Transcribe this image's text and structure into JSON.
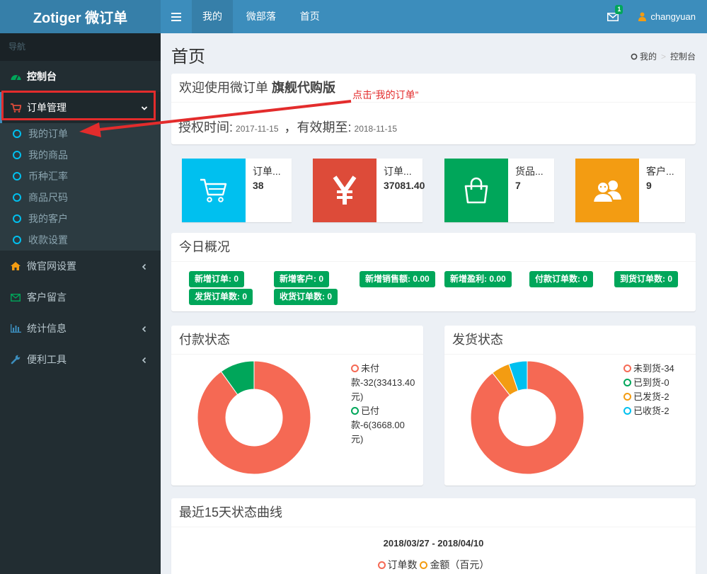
{
  "header": {
    "logo_text": "Zotiger 微订单",
    "nav": [
      {
        "label": "我的",
        "active": true
      },
      {
        "label": "微部落",
        "active": false
      },
      {
        "label": "首页",
        "active": false
      }
    ],
    "mail_badge": "1",
    "username": "changyuan"
  },
  "sidebar": {
    "header": "导航",
    "dashboard": "控制台",
    "order_mgmt": "订单管理",
    "sub_items": [
      "我的订单",
      "我的商品",
      "币种汇率",
      "商品尺码",
      "我的客户",
      "收款设置"
    ],
    "site_settings": "微官网设置",
    "messages": "客户留言",
    "stats": "统计信息",
    "tools": "便利工具"
  },
  "page": {
    "title": "首页",
    "breadcrumb": [
      "我的",
      "控制台"
    ]
  },
  "welcome": {
    "prefix": "欢迎使用微订单 ",
    "edition": "旗舰代购版",
    "auth_label": "授权时间:",
    "auth_date": "2017-11-15",
    "valid_label": "，有效期至:",
    "valid_date": "2018-11-15"
  },
  "annotation": "点击“我的订单”",
  "stats": [
    {
      "label": "订单...",
      "value": "38",
      "color": "#00c0ef",
      "icon": "cart-icon"
    },
    {
      "label": "订单...",
      "value": "37081.40",
      "color": "#dd4b39",
      "icon": "yen-icon"
    },
    {
      "label": "货品...",
      "value": "7",
      "color": "#00a65a",
      "icon": "bag-icon"
    },
    {
      "label": "客户...",
      "value": "9",
      "color": "#f39c12",
      "icon": "users-icon"
    }
  ],
  "today": {
    "title": "今日概况",
    "tags": [
      "新增订单: 0",
      "新增客户: 0",
      "新增销售额: 0.00",
      "新增盈利: 0.00",
      "付款订单数: 0",
      "到货订单数: 0",
      "发货订单数: 0",
      "收货订单数: 0"
    ]
  },
  "payment": {
    "title": "付款状态",
    "legend": [
      {
        "line1": "未付",
        "line2": "款-32(33413.40",
        "line3": "元)",
        "color": "#f56954"
      },
      {
        "line1": "已付",
        "line2": "款-6(3668.00",
        "line3": "元)",
        "color": "#00a65a"
      }
    ],
    "values": [
      33413.4,
      3668.0
    ],
    "colors": [
      "#f56954",
      "#00a65a"
    ]
  },
  "shipping": {
    "title": "发货状态",
    "legend": [
      {
        "label": "未到货-34",
        "color": "#f56954"
      },
      {
        "label": "已到货-0",
        "color": "#00a65a"
      },
      {
        "label": "已发货-2",
        "color": "#f39c12"
      },
      {
        "label": "已收货-2",
        "color": "#00c0ef"
      }
    ],
    "values": [
      34,
      0,
      2,
      2
    ],
    "colors": [
      "#f56954",
      "#00a65a",
      "#f39c12",
      "#00c0ef"
    ]
  },
  "trend": {
    "title": "最近15天状态曲线",
    "date_range": "2018/03/27 - 2018/04/10",
    "legend": [
      {
        "label": "订单数",
        "color": "#f56954"
      },
      {
        "label": "金额（百元）",
        "color": "#f39c12"
      }
    ]
  }
}
